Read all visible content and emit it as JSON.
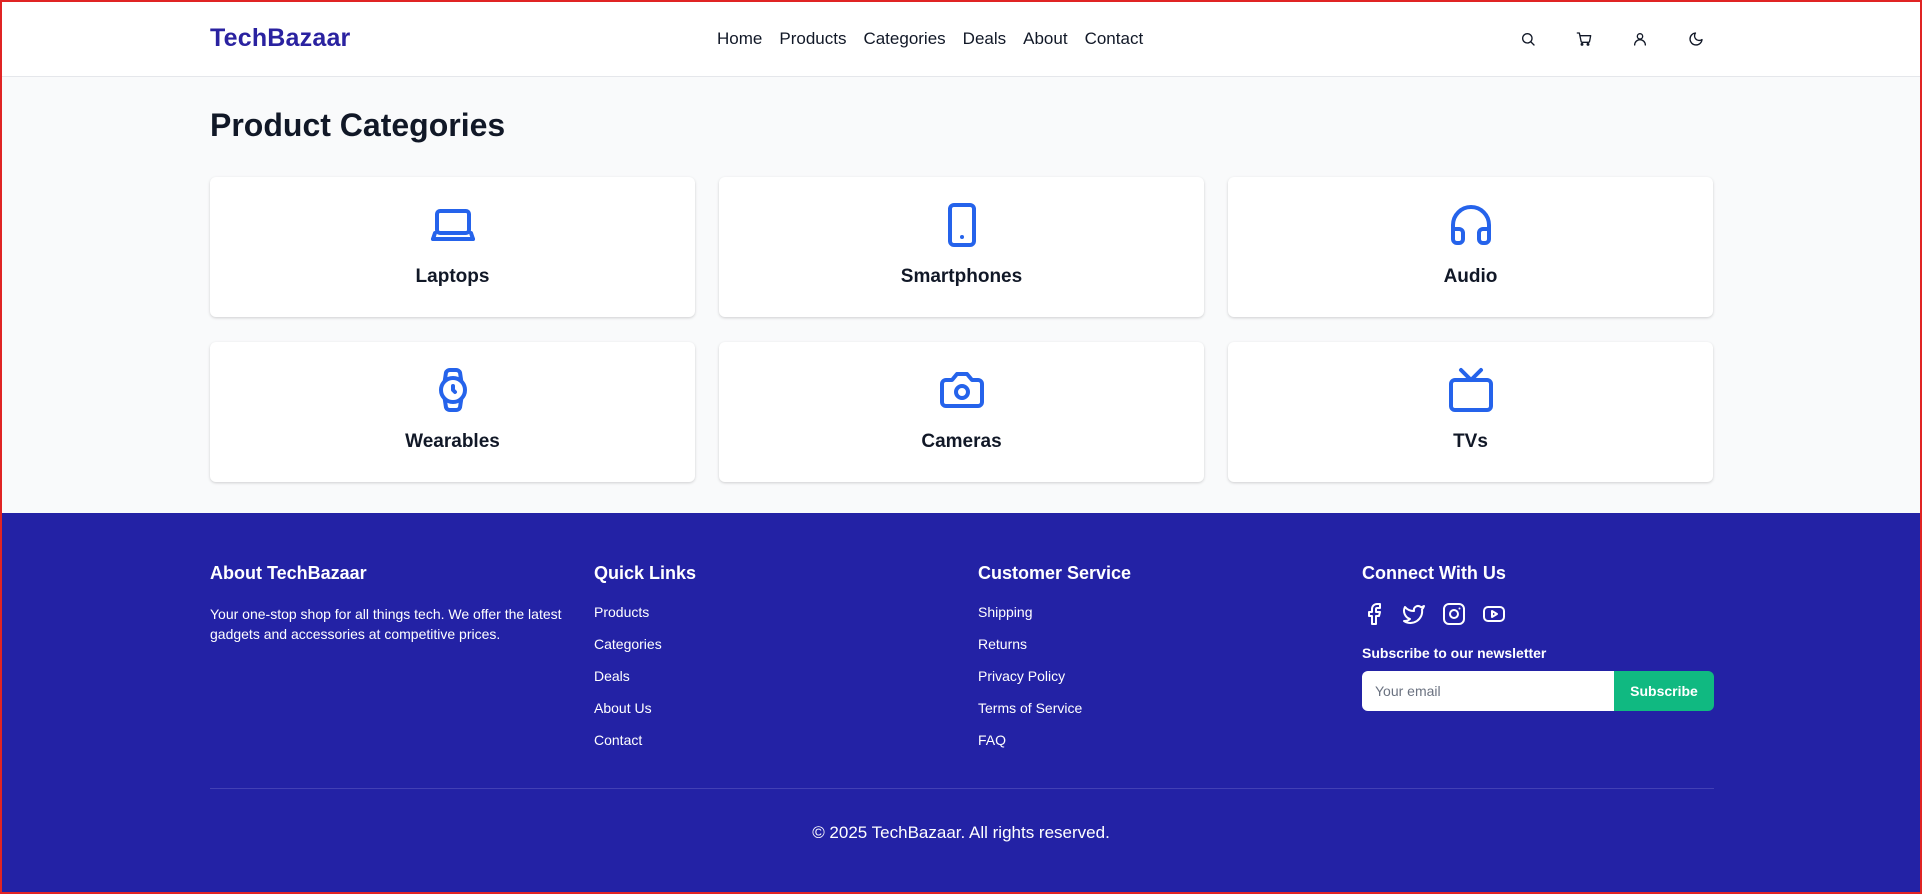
{
  "header": {
    "logo": "TechBazaar",
    "nav": [
      "Home",
      "Products",
      "Categories",
      "Deals",
      "About",
      "Contact"
    ],
    "icons": [
      "search-icon",
      "cart-icon",
      "user-icon",
      "moon-icon"
    ]
  },
  "main": {
    "title": "Product Categories",
    "categories": [
      {
        "label": "Laptops",
        "icon": "laptop-icon"
      },
      {
        "label": "Smartphones",
        "icon": "smartphone-icon"
      },
      {
        "label": "Audio",
        "icon": "headphones-icon"
      },
      {
        "label": "Wearables",
        "icon": "watch-icon"
      },
      {
        "label": "Cameras",
        "icon": "camera-icon"
      },
      {
        "label": "TVs",
        "icon": "tv-icon"
      }
    ]
  },
  "footer": {
    "about": {
      "heading": "About TechBazaar",
      "text": "Your one-stop shop for all things tech. We offer the latest gadgets and accessories at competitive prices."
    },
    "quick_links": {
      "heading": "Quick Links",
      "items": [
        "Products",
        "Categories",
        "Deals",
        "About Us",
        "Contact"
      ]
    },
    "customer_service": {
      "heading": "Customer Service",
      "items": [
        "Shipping",
        "Returns",
        "Privacy Policy",
        "Terms of Service",
        "FAQ"
      ]
    },
    "connect": {
      "heading": "Connect With Us",
      "social_icons": [
        "facebook-icon",
        "twitter-icon",
        "instagram-icon",
        "youtube-icon"
      ],
      "newsletter_label": "Subscribe to our newsletter",
      "email_placeholder": "Your email",
      "subscribe_label": "Subscribe"
    },
    "copyright": "© 2025 TechBazaar. All rights reserved."
  },
  "colors": {
    "brand": "#2a22a0",
    "footer_bg": "#2322a5",
    "accent_icon": "#2563eb",
    "subscribe_button": "#10b981",
    "page_bg": "#f9fafb"
  }
}
